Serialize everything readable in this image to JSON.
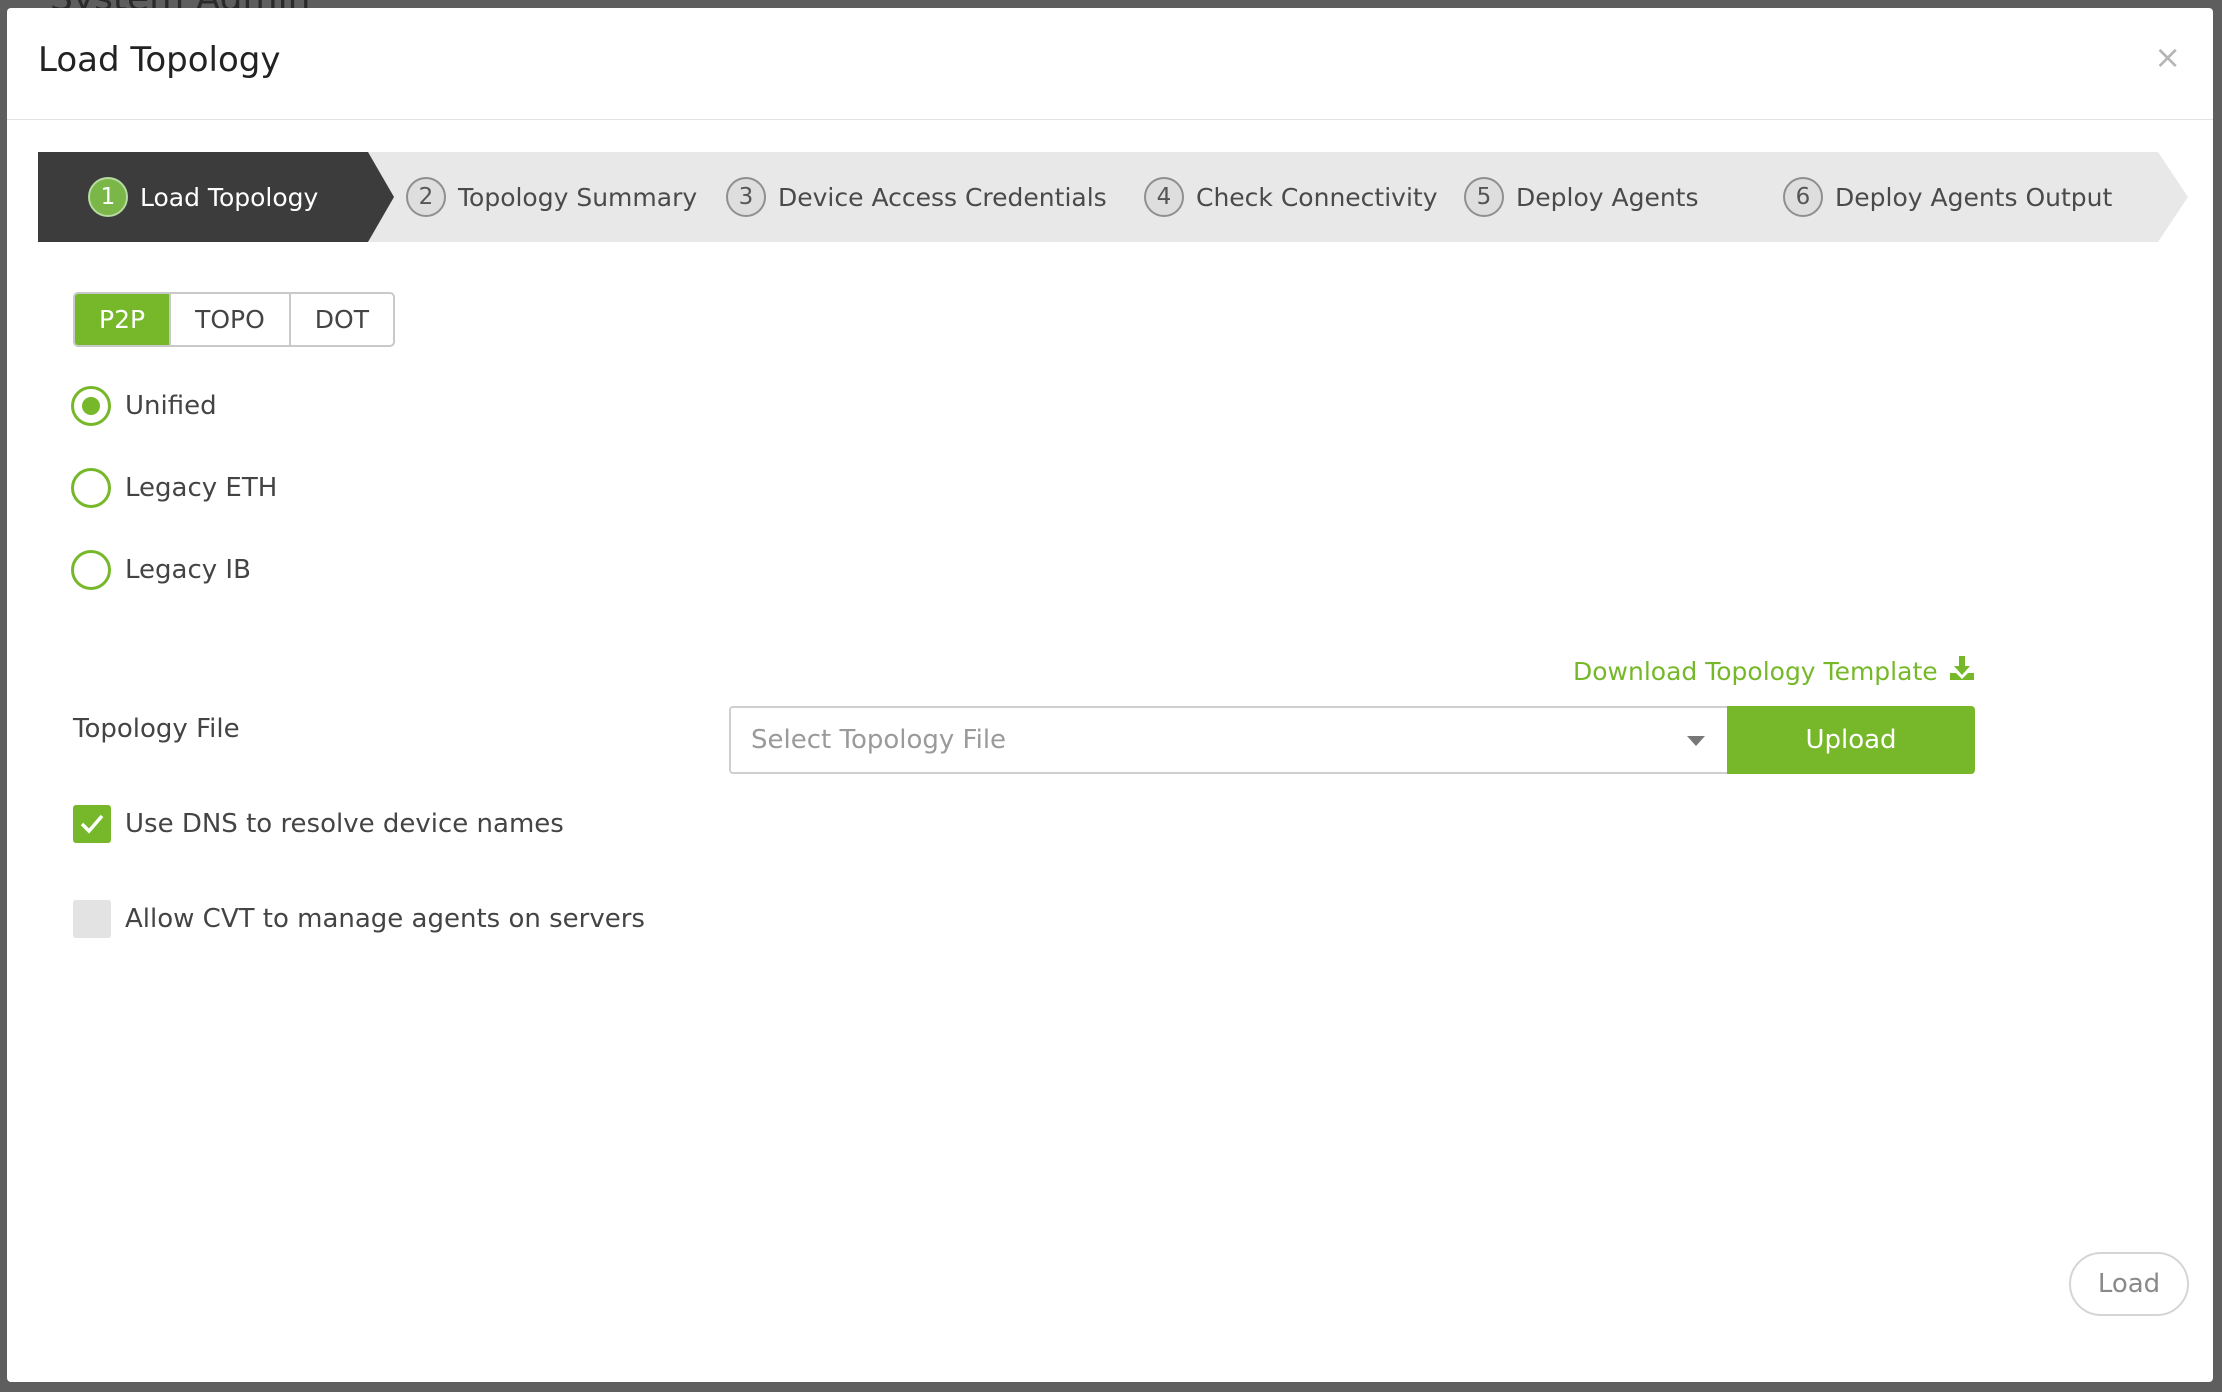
{
  "backdrop": {
    "title": "System Admin"
  },
  "modal": {
    "title": "Load Topology",
    "close_label": "×"
  },
  "wizard": {
    "steps": [
      {
        "num": "1",
        "label": "Load Topology",
        "active": true
      },
      {
        "num": "2",
        "label": "Topology Summary",
        "active": false
      },
      {
        "num": "3",
        "label": "Device Access Credentials",
        "active": false
      },
      {
        "num": "4",
        "label": "Check Connectivity",
        "active": false
      },
      {
        "num": "5",
        "label": "Deploy Agents",
        "active": false
      },
      {
        "num": "6",
        "label": "Deploy Agents Output",
        "active": false
      }
    ]
  },
  "format_tabs": [
    {
      "label": "P2P",
      "selected": true
    },
    {
      "label": "TOPO",
      "selected": false
    },
    {
      "label": "DOT",
      "selected": false
    }
  ],
  "radio_options": [
    {
      "label": "Unified",
      "checked": true
    },
    {
      "label": "Legacy ETH",
      "checked": false
    },
    {
      "label": "Legacy IB",
      "checked": false
    }
  ],
  "download": {
    "label": "Download Topology Template",
    "icon": "download-icon"
  },
  "topology_file": {
    "label": "Topology File",
    "placeholder": "Select Topology File",
    "upload_label": "Upload"
  },
  "checkboxes": [
    {
      "label": "Use DNS to resolve device names",
      "checked": true
    },
    {
      "label": "Allow CVT to manage agents on servers",
      "checked": false
    }
  ],
  "footer": {
    "load_label": "Load"
  },
  "colors": {
    "accent": "#76b82a",
    "active_step_bg": "#3c3c3c",
    "step_bar_bg": "#e8e8e8"
  }
}
